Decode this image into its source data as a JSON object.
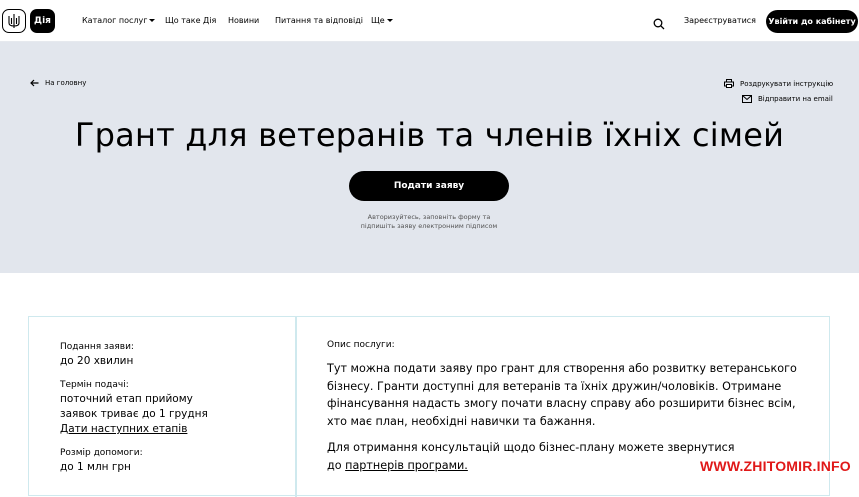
{
  "header": {
    "logo_text": "Дія",
    "nav": {
      "catalog": "Каталог послуг",
      "about": "Що таке Дія",
      "news": "Новини",
      "faq": "Питання та відповіді",
      "more": "Ще"
    },
    "register": "Зареєструватися",
    "login": "Увійти до кабінету"
  },
  "hero": {
    "back": "На головну",
    "print": "Роздрукувати інструкцію",
    "email": "Відправити на email",
    "title": "Грант для ветеранів та членів їхніх сімей",
    "apply": "Подати заяву",
    "hint_line1": "Авторизуйтесь, заповніть форму та",
    "hint_line2": "підпишіть заяву електронним підписом"
  },
  "info": {
    "submission_label": "Подання заяви:",
    "submission_value": "до 20 хвилин",
    "deadline_label": "Термін подачі:",
    "deadline_line1": "поточний етап прийому",
    "deadline_line2": "заявок триває до 1 грудня",
    "deadline_link": "Дати наступних етапів",
    "amount_label": "Розмір допомоги:",
    "amount_value": "до 1 млн грн"
  },
  "description": {
    "label": "Опис послуги:",
    "p1_l1": "Тут можна подати заяву про грант для створення або розвитку ветеранського",
    "p1_l2": "бізнесу. Гранти доступні для ветеранів та їхніх дружин/чоловіків. Отримане",
    "p1_l3": "фінансування надасть змогу почати власну справу або розширити бізнес всім,",
    "p1_l4": "хто має план, необхідні навички та бажання.",
    "p2_l1": "Для отримання консультацій щодо бізнес-плану можете звернутися",
    "p2_prefix": "до ",
    "p2_link": "партнерів програми."
  },
  "watermark": "WWW.ZHITOMIR.INFO",
  "icons": {
    "search": "search-icon",
    "print": "printer-icon",
    "email": "envelope-icon",
    "back": "arrow-left-icon",
    "logo": "trident-icon"
  }
}
